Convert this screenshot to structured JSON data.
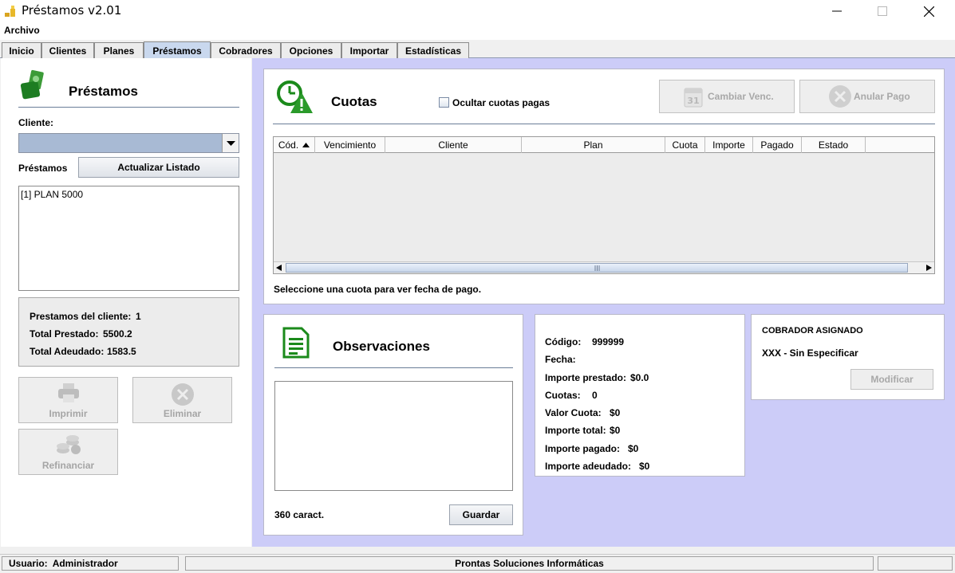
{
  "window": {
    "title": "Préstamos v2.01",
    "icon": "coin-stack-icon"
  },
  "menu": {
    "archivo": "Archivo"
  },
  "tabs": [
    {
      "label": "Inicio"
    },
    {
      "label": "Clientes"
    },
    {
      "label": "Planes"
    },
    {
      "label": "Préstamos",
      "active": true
    },
    {
      "label": "Cobradores"
    },
    {
      "label": "Opciones"
    },
    {
      "label": "Importar"
    },
    {
      "label": "Estadísticas"
    }
  ],
  "left": {
    "title": "Préstamos",
    "cliente_label": "Cliente:",
    "cliente_value": "",
    "prestamos_label": "Préstamos",
    "refresh_button": "Actualizar Listado",
    "loans": [
      "[1] PLAN 5000"
    ],
    "summary": {
      "count_label": "Prestamos del cliente:",
      "count_value": "1",
      "lent_label": "Total Prestado:",
      "lent_value": "5500.2",
      "owed_label": "Total Adeudado:",
      "owed_value": "1583.5"
    },
    "buttons": {
      "print": "Imprimir",
      "delete": "Eliminar",
      "refinance": "Refinanciar"
    }
  },
  "cuotas": {
    "title": "Cuotas",
    "hide_paid_label": "Ocultar cuotas pagas",
    "hide_paid_checked": false,
    "change_due_button": "Cambiar Venc.",
    "cancel_payment_button": "Anular Pago",
    "columns": [
      "Cód.",
      "Vencimiento",
      "Cliente",
      "Plan",
      "Cuota",
      "Importe",
      "Pagado",
      "Estado"
    ],
    "rows": [],
    "hint": "Seleccione una cuota para ver fecha de pago."
  },
  "observaciones": {
    "title": "Observaciones",
    "text": "",
    "chars": "360 caract.",
    "save_button": "Guardar"
  },
  "details": {
    "codigo_label": "Código:",
    "codigo_value": "999999",
    "fecha_label": "Fecha:",
    "fecha_value": "",
    "importe_prestado_label": "Importe prestado:",
    "importe_prestado_value": "$0.0",
    "cuotas_label": "Cuotas:",
    "cuotas_value": "0",
    "valor_cuota_label": "Valor Cuota:",
    "valor_cuota_value": "$0",
    "importe_total_label": "Importe total:",
    "importe_total_value": "$0",
    "importe_pagado_label": "Importe pagado:",
    "importe_pagado_value": "$0",
    "importe_adeudado_label": "Importe adeudado:",
    "importe_adeudado_value": "$0"
  },
  "cobrador": {
    "title": "COBRADOR ASIGNADO",
    "value": "XXX - Sin Especificar",
    "modify_button": "Modificar"
  },
  "status": {
    "user_label": "Usuario:",
    "user_value": "Administrador",
    "company": "Prontas Soluciones Informáticas"
  },
  "colors": {
    "panel_bg": "#ccccf8",
    "active_tab": "#c9d8ee",
    "icon_green": "#2d9f2d",
    "combo_fill": "#a8bad4"
  }
}
